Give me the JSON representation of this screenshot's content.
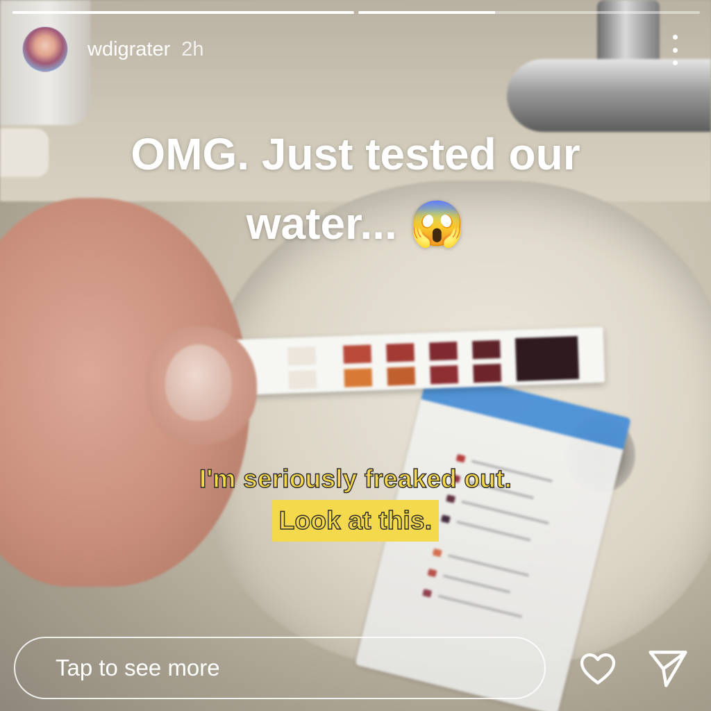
{
  "story": {
    "progress": [
      1.0,
      0.4
    ],
    "user": {
      "username": "wdigrater",
      "time": "2h"
    },
    "caption": {
      "line1": "OMG. Just tested our",
      "line2": "water... 😱"
    },
    "overlay_text": {
      "line1": "I'm seriously freaked out.",
      "line2": "Look at this."
    },
    "reply": {
      "placeholder": "Tap to see more"
    },
    "icons": [
      "more-options-icon",
      "heart-icon",
      "send-icon"
    ],
    "colors": {
      "overlay_text": "#f4d94c",
      "ui_text": "#ffffff"
    }
  }
}
